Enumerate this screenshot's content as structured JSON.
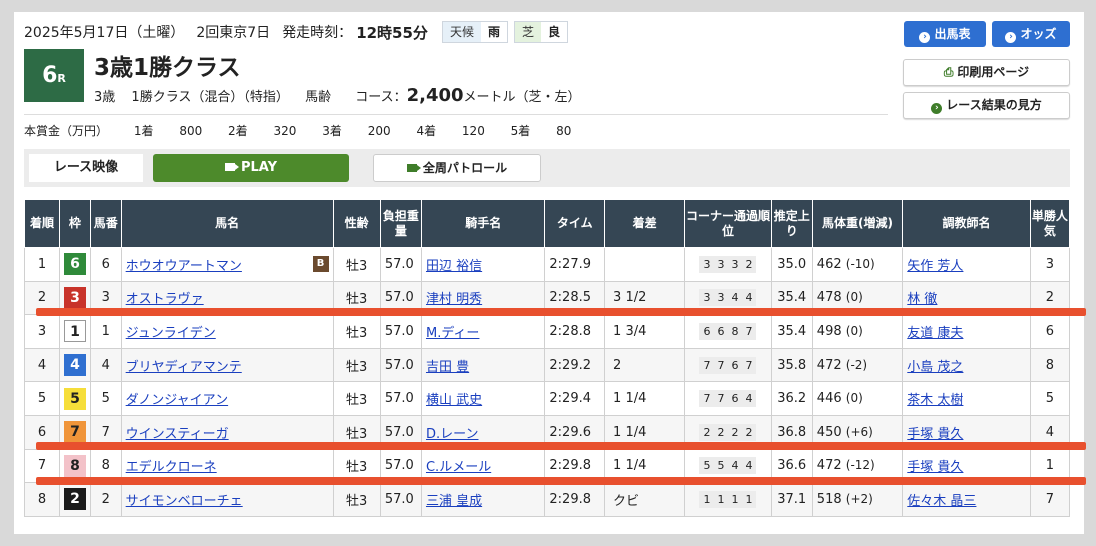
{
  "header": {
    "date": "2025年5月17日（土曜）",
    "meeting": "2回東京7日",
    "start_label": "発走時刻：",
    "start_time": "12時55分",
    "weather_label": "天候",
    "weather_value": "雨",
    "turf_label": "芝",
    "turf_value": "良"
  },
  "race": {
    "number": "6",
    "number_suffix": "R",
    "name": "3歳1勝クラス",
    "age": "3歳",
    "class": "1勝クラス（混合）（特指）",
    "weight_rule": "馬齢",
    "course_label": "コース：",
    "distance": "2,400",
    "course_detail": "メートル（芝・左）"
  },
  "prize": {
    "label": "本賞金（万円）",
    "items": [
      "1着",
      "800",
      "2着",
      "320",
      "3着",
      "200",
      "4着",
      "120",
      "5着",
      "80"
    ]
  },
  "buttons": {
    "entries": "出馬表",
    "odds": "オッズ",
    "print": "印刷用ページ",
    "howto": "レース結果の見方"
  },
  "video": {
    "label": "レース映像",
    "play": "PLAY",
    "patrol": "全周パトロール"
  },
  "table": {
    "headers": [
      "着順",
      "枠",
      "馬番",
      "馬名",
      "性齢",
      "負担重量",
      "騎手名",
      "タイム",
      "着差",
      "コーナー通過順位",
      "推定上り",
      "馬体重(増減)",
      "調教師名",
      "単勝人気"
    ],
    "rows": [
      {
        "rank": "1",
        "waku": "6",
        "waku_bg": "#2f8a3a",
        "waku_fg": "#ffffff",
        "num": "6",
        "horse": "ホウオウアートマン",
        "blinker": "B",
        "sexage": "牡3",
        "weight": "57.0",
        "jockey": "田辺 裕信",
        "time": "2:27.9",
        "margin": "",
        "corners": [
          "3",
          "3",
          "3",
          "2"
        ],
        "last": "35.0",
        "bw": "462",
        "bwdiff": "(-10)",
        "trainer": "矢作 芳人",
        "pop": "3"
      },
      {
        "rank": "2",
        "waku": "3",
        "waku_bg": "#c8332a",
        "waku_fg": "#ffffff",
        "num": "3",
        "horse": "オストラヴァ",
        "blinker": "",
        "sexage": "牡3",
        "weight": "57.0",
        "jockey": "津村 明秀",
        "time": "2:28.5",
        "margin": "3 1/2",
        "corners": [
          "3",
          "3",
          "4",
          "4"
        ],
        "last": "35.4",
        "bw": "478",
        "bwdiff": "(0)",
        "trainer": "林 徹",
        "pop": "2"
      },
      {
        "rank": "3",
        "waku": "1",
        "waku_bg": "#ffffff",
        "waku_fg": "#222222",
        "num": "1",
        "horse": "ジュンライデン",
        "blinker": "",
        "sexage": "牡3",
        "weight": "57.0",
        "jockey": "M.ディー",
        "time": "2:28.8",
        "margin": "1 3/4",
        "corners": [
          "6",
          "6",
          "8",
          "7"
        ],
        "last": "35.4",
        "bw": "498",
        "bwdiff": "(0)",
        "trainer": "友道 康夫",
        "pop": "6"
      },
      {
        "rank": "4",
        "waku": "4",
        "waku_bg": "#2f6fd0",
        "waku_fg": "#ffffff",
        "num": "4",
        "horse": "ブリヤディアマンテ",
        "blinker": "",
        "sexage": "牡3",
        "weight": "57.0",
        "jockey": "吉田 豊",
        "time": "2:29.2",
        "margin": "2",
        "corners": [
          "7",
          "7",
          "6",
          "7"
        ],
        "last": "35.8",
        "bw": "472",
        "bwdiff": "(-2)",
        "trainer": "小島 茂之",
        "pop": "8"
      },
      {
        "rank": "5",
        "waku": "5",
        "waku_bg": "#f6de3a",
        "waku_fg": "#222222",
        "num": "5",
        "horse": "ダノンジャイアン",
        "blinker": "",
        "sexage": "牡3",
        "weight": "57.0",
        "jockey": "横山 武史",
        "time": "2:29.4",
        "margin": "1 1/4",
        "corners": [
          "7",
          "7",
          "6",
          "4"
        ],
        "last": "36.2",
        "bw": "446",
        "bwdiff": "(0)",
        "trainer": "茶木 太樹",
        "pop": "5"
      },
      {
        "rank": "6",
        "waku": "7",
        "waku_bg": "#f0953a",
        "waku_fg": "#222222",
        "num": "7",
        "horse": "ウインスティーガ",
        "blinker": "",
        "sexage": "牡3",
        "weight": "57.0",
        "jockey": "D.レーン",
        "time": "2:29.6",
        "margin": "1 1/4",
        "corners": [
          "2",
          "2",
          "2",
          "2"
        ],
        "last": "36.8",
        "bw": "450",
        "bwdiff": "(+6)",
        "trainer": "手塚 貴久",
        "pop": "4"
      },
      {
        "rank": "7",
        "waku": "8",
        "waku_bg": "#f3c2c9",
        "waku_fg": "#222222",
        "num": "8",
        "horse": "エデルクローネ",
        "blinker": "",
        "sexage": "牡3",
        "weight": "57.0",
        "jockey": "C.ルメール",
        "time": "2:29.8",
        "margin": "1 1/4",
        "corners": [
          "5",
          "5",
          "4",
          "4"
        ],
        "last": "36.6",
        "bw": "472",
        "bwdiff": "(-12)",
        "trainer": "手塚 貴久",
        "pop": "1"
      },
      {
        "rank": "8",
        "waku": "2",
        "waku_bg": "#1a1a1a",
        "waku_fg": "#ffffff",
        "num": "2",
        "horse": "サイモンベローチェ",
        "blinker": "",
        "sexage": "牡3",
        "weight": "57.0",
        "jockey": "三浦 皇成",
        "time": "2:29.8",
        "margin": "クビ",
        "corners": [
          "1",
          "1",
          "1",
          "1"
        ],
        "last": "37.1",
        "bw": "518",
        "bwdiff": "(+2)",
        "trainer": "佐々木 晶三",
        "pop": "7"
      }
    ]
  },
  "colors": {
    "accent_blue": "#2e6fd1",
    "race_badge": "#2d6b45",
    "play_green": "#4d8a2b",
    "header_bg": "#354654",
    "annotation_red": "#e8502e"
  }
}
